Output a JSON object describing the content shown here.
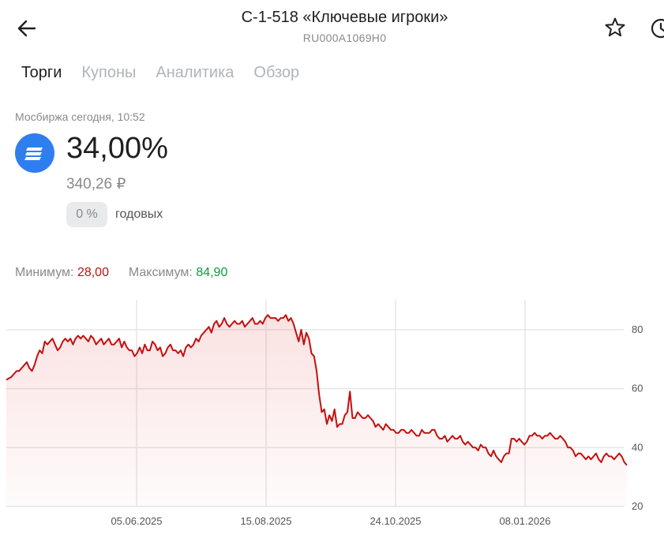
{
  "header": {
    "title": "С-1-518 «Ключевые игроки»",
    "subtitle": "RU000A1069H0",
    "icons": [
      "arrow-left-icon",
      "star-icon",
      "clock-icon"
    ]
  },
  "tabs": [
    {
      "label": "Торги",
      "active": true
    },
    {
      "label": "Купоны",
      "active": false
    },
    {
      "label": "Аналитика",
      "active": false
    },
    {
      "label": "Обзор",
      "active": false
    }
  ],
  "quote": {
    "exchange": "Мосбиржа сегодня, 10:52",
    "price_percent": "34,00%",
    "price_rub": "340,26 ₽",
    "yield_chip": "0 %",
    "yield_label": "годовых"
  },
  "stats": {
    "min_label": "Минимум:",
    "min_value": "28,00",
    "max_label": "Максимум:",
    "max_value": "84,90"
  },
  "colors": {
    "line": "#c40f0f",
    "min": "#c40f0f",
    "max": "#0f9a3e",
    "accent": "#2f7ef0"
  },
  "chart_data": {
    "type": "area",
    "x_tick_labels": [
      "05.06.2025",
      "15.08.2025",
      "24.10.2025",
      "08.01.2026"
    ],
    "y_ticks": [
      20,
      40,
      60,
      80
    ],
    "ylim": [
      20,
      86
    ],
    "grid": true,
    "series": [
      {
        "values": [
          63,
          63.5,
          64,
          65,
          66,
          66,
          67,
          68,
          69,
          67,
          66,
          68,
          71,
          73,
          72,
          76,
          75,
          76,
          77,
          75,
          73,
          74,
          76,
          77,
          76,
          77,
          75,
          77,
          78,
          77,
          78,
          77,
          76,
          78,
          77,
          75,
          76,
          77,
          75,
          76,
          77,
          75,
          75,
          76,
          77,
          74,
          76,
          74,
          73,
          73,
          71,
          72,
          74,
          72,
          75,
          73,
          73,
          76,
          75,
          73,
          74,
          71,
          72,
          74,
          75,
          73,
          73,
          72,
          73,
          71,
          74,
          75,
          74,
          75,
          77,
          76,
          78,
          79,
          80,
          81,
          79,
          82,
          83,
          81,
          82,
          84,
          82,
          81,
          82,
          83,
          82,
          82,
          83,
          81,
          82,
          83,
          84,
          82,
          82,
          83,
          82,
          84,
          85,
          84,
          84,
          84,
          83,
          84,
          84,
          85,
          83,
          84,
          82,
          79,
          76,
          80,
          75,
          79,
          77,
          72,
          71,
          66,
          58,
          52,
          53,
          48,
          51,
          49,
          53,
          47,
          48,
          48,
          51,
          52,
          59,
          50,
          50,
          52,
          51,
          50,
          50,
          51,
          50,
          49,
          47,
          48,
          47,
          46,
          48,
          47,
          46,
          46,
          45,
          45,
          46,
          46,
          45,
          45,
          46,
          45,
          44,
          44,
          46,
          45,
          45,
          45,
          46,
          46,
          44,
          43,
          43,
          44,
          42,
          43,
          44,
          43,
          43,
          44,
          42,
          41,
          42,
          41,
          40,
          40,
          39,
          41,
          40,
          40,
          38,
          37,
          39,
          37,
          36,
          35,
          37,
          38,
          38,
          43,
          43,
          42,
          43,
          42,
          41,
          42,
          44,
          44,
          45,
          44,
          44,
          43,
          44,
          44,
          45,
          44,
          43,
          43,
          44,
          43,
          42,
          40,
          40,
          39,
          37,
          38,
          38,
          37,
          36,
          37,
          36,
          37,
          38,
          36,
          35,
          37,
          38,
          37,
          37,
          36,
          37,
          38,
          37,
          35,
          34
        ]
      }
    ]
  }
}
